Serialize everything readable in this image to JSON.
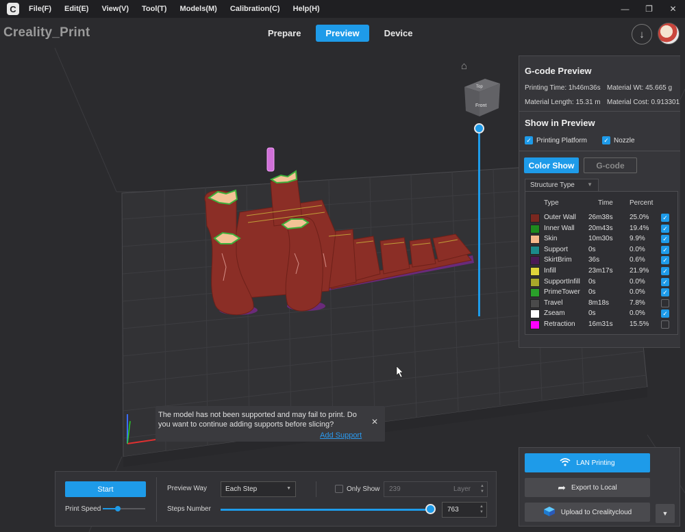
{
  "menubar": {
    "items": [
      "File(F)",
      "Edit(E)",
      "View(V)",
      "Tool(T)",
      "Models(M)",
      "Calibration(C)",
      "Help(H)"
    ],
    "window_controls": [
      "—",
      "❐",
      "✕"
    ]
  },
  "header": {
    "app_title": "Creality_Print",
    "tabs": [
      {
        "label": "Prepare",
        "active": false
      },
      {
        "label": "Preview",
        "active": true
      },
      {
        "label": "Device",
        "active": false
      }
    ]
  },
  "viewcube": {
    "top": "Top",
    "front": "Front"
  },
  "notice": {
    "text": "The model has not been supported and may fail to print. Do you want to continue adding supports before slicing?",
    "link": "Add Support",
    "close": "✕"
  },
  "gcode_preview": {
    "title": "G-code Preview",
    "printing_time": "Printing Time: 1h46m36s",
    "material_wt": "Material Wt: 45.665 g",
    "material_length": "Material Length: 15.31 m",
    "material_cost": "Material Cost: 0.913301",
    "show_title": "Show in Preview",
    "show_platform": "Printing Platform",
    "show_nozzle": "Nozzle",
    "color_show": "Color Show",
    "gcode": "G-code",
    "structure_tab": "Structure Type",
    "columns": {
      "type": "Type",
      "time": "Time",
      "percent": "Percent"
    },
    "rows": [
      {
        "name": "Outer Wall",
        "time": "26m38s",
        "percent": "25.0%",
        "color": "#7a2820",
        "checked": true
      },
      {
        "name": "Inner Wall",
        "time": "20m43s",
        "percent": "19.4%",
        "color": "#1e8a1e",
        "checked": true
      },
      {
        "name": "Skin",
        "time": "10m30s",
        "percent": "9.9%",
        "color": "#f5b88a",
        "checked": true
      },
      {
        "name": "Support",
        "time": "0s",
        "percent": "0.0%",
        "color": "#1a8a8a",
        "checked": true
      },
      {
        "name": "SkirtBrim",
        "time": "36s",
        "percent": "0.6%",
        "color": "#4a1a55",
        "checked": true
      },
      {
        "name": "Infill",
        "time": "23m17s",
        "percent": "21.9%",
        "color": "#e0d43a",
        "checked": true
      },
      {
        "name": "SupportInfill",
        "time": "0s",
        "percent": "0.0%",
        "color": "#a8a82a",
        "checked": true
      },
      {
        "name": "PrimeTower",
        "time": "0s",
        "percent": "0.0%",
        "color": "#2aa02a",
        "checked": true
      },
      {
        "name": "Travel",
        "time": "8m18s",
        "percent": "7.8%",
        "color": "#4a4a4a",
        "checked": false
      },
      {
        "name": "Zseam",
        "time": "0s",
        "percent": "0.0%",
        "color": "#ffffff",
        "checked": true
      },
      {
        "name": "Retraction",
        "time": "16m31s",
        "percent": "15.5%",
        "color": "#ff00ff",
        "checked": false
      }
    ]
  },
  "bottom": {
    "start": "Start",
    "print_speed": "Print Speed",
    "preview_way": "Preview Way",
    "preview_way_value": "Each Step",
    "only_show": "Only Show",
    "layer_value": "239",
    "layer_unit": "Layer",
    "steps_number": "Steps Number",
    "steps_value": "763"
  },
  "upload": {
    "lan": "LAN Printing",
    "export": "Export to Local",
    "cloud": "Upload to Crealitycloud"
  },
  "colors": {
    "accent": "#1e9be9",
    "model": "#8b2e26",
    "brim": "#6a2a7a"
  }
}
